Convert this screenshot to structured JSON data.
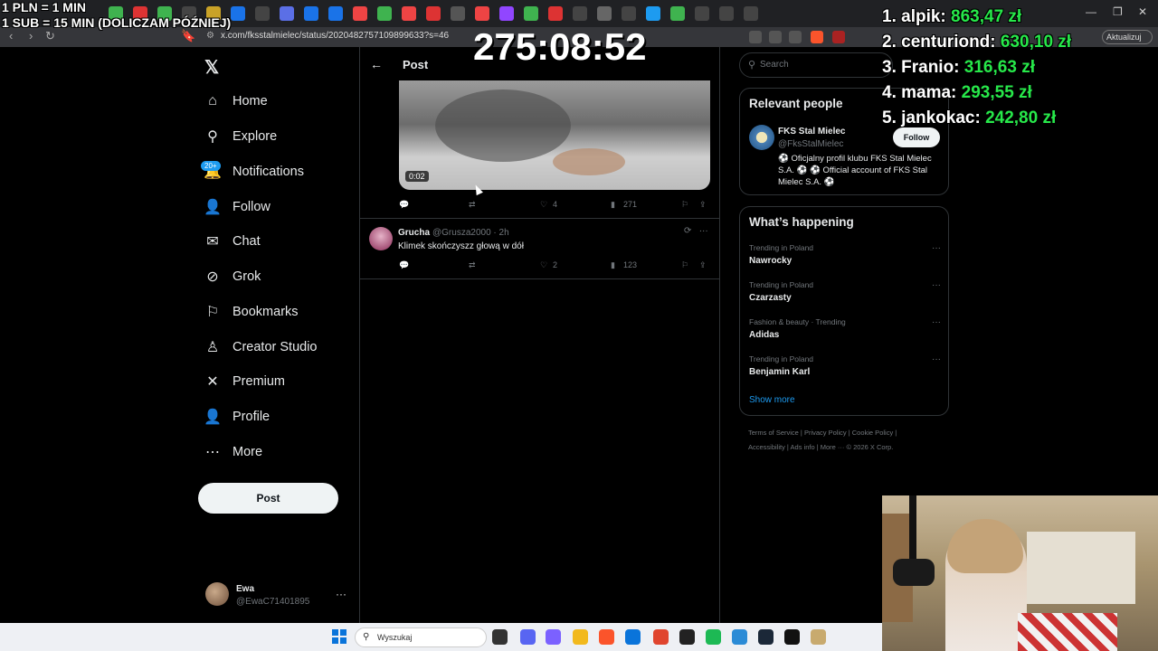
{
  "overlay": {
    "line1": "1 PLN = 1 MIN",
    "line2": "1 SUB = 15 MIN (DOLICZAM PÓŹNIEJ)",
    "timer": "275:08:52"
  },
  "leaderboard": [
    {
      "label": "1. alpik: ",
      "amount": "863,47 zł"
    },
    {
      "label": "2. centuriond: ",
      "amount": "630,10 zł"
    },
    {
      "label": "3. Franio: ",
      "amount": "316,63 zł"
    },
    {
      "label": "4. mama: ",
      "amount": "293,55 zł"
    },
    {
      "label": "5. jankokac: ",
      "amount": "242,80 zł"
    }
  ],
  "browser": {
    "url": "x.com/fksstalmielec/status/2020482757109899633?s=46",
    "update_label": "Aktualizuj"
  },
  "sidebar": {
    "items": [
      {
        "label": "Home"
      },
      {
        "label": "Explore"
      },
      {
        "label": "Notifications"
      },
      {
        "label": "Follow"
      },
      {
        "label": "Chat"
      },
      {
        "label": "Grok"
      },
      {
        "label": "Bookmarks"
      },
      {
        "label": "Creator Studio"
      },
      {
        "label": "Premium"
      },
      {
        "label": "Profile"
      },
      {
        "label": "More"
      }
    ],
    "notif_badge": "20+",
    "post_label": "Post",
    "account": {
      "name": "Ewa",
      "handle": "@EwaC71401895"
    }
  },
  "main": {
    "header": "Post",
    "video_time": "0:02",
    "post_actions": {
      "likes": "4",
      "views": "271"
    },
    "reply": {
      "name": "Grucha",
      "handle": "@Grusza2000 · 2h",
      "text": "Klimek skończyszz głową w dół",
      "likes": "2",
      "views": "123"
    }
  },
  "right": {
    "search_placeholder": "Search",
    "relevant_title": "Relevant people",
    "person": {
      "name": "FKS Stal Mielec",
      "handle": "@FksStalMielec",
      "follow": "Follow",
      "bio": "⚽ Oficjalny profil klubu FKS Stal Mielec S.A. ⚽ ⚽ Official account of FKS Stal Mielec S.A. ⚽"
    },
    "happening_title": "What’s happening",
    "trends": [
      {
        "context": "Trending in Poland",
        "name": "Nawrocky"
      },
      {
        "context": "Trending in Poland",
        "name": "Czarzasty"
      },
      {
        "context": "Fashion & beauty · Trending",
        "name": "Adidas"
      },
      {
        "context": "Trending in Poland",
        "name": "Benjamin Karl"
      }
    ],
    "show_more": "Show more",
    "footer1": "Terms of Service  |  Privacy Policy  |  Cookie Policy  |",
    "footer2": "Accessibility  |  Ads info  |  More ···  © 2026 X Corp."
  },
  "taskbar": {
    "search_placeholder": "Wyszukaj"
  }
}
